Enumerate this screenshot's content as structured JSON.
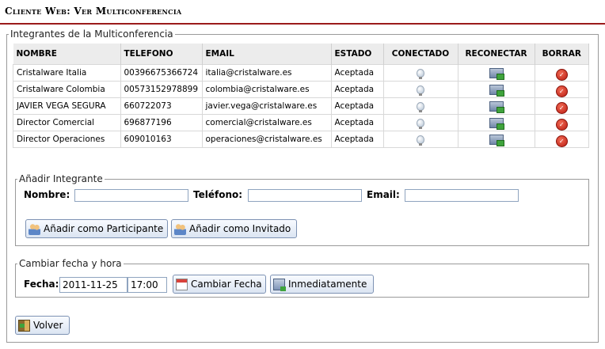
{
  "header": {
    "title": "Cliente Web: Ver Multiconferencia"
  },
  "members": {
    "legend": "Integrantes de la Multiconferencia",
    "columns": [
      "NOMBRE",
      "TELEFONO",
      "EMAIL",
      "ESTADO",
      "CONECTADO",
      "RECONECTAR",
      "BORRAR"
    ],
    "rows": [
      {
        "name": "Cristalware Italia",
        "phone": "00396675366724",
        "email": "italia@cristalware.es",
        "status": "Aceptada"
      },
      {
        "name": "Cristalware Colombia",
        "phone": "00573152978899",
        "email": "colombia@cristalware.es",
        "status": "Aceptada"
      },
      {
        "name": "JAVIER VEGA SEGURA",
        "phone": "660722073",
        "email": "javier.vega@cristalware.es",
        "status": "Aceptada"
      },
      {
        "name": "Director Comercial",
        "phone": "696877196",
        "email": "comercial@cristalware.es",
        "status": "Aceptada"
      },
      {
        "name": "Director Operaciones",
        "phone": "609010163",
        "email": "operaciones@cristalware.es",
        "status": "Aceptada"
      }
    ],
    "icons": {
      "connected": "lightbulb-icon",
      "reconnect": "reconnect-icon",
      "delete": "trash-icon"
    }
  },
  "add": {
    "legend": "Añadir Integrante",
    "name_label": "Nombre:",
    "name_value": "",
    "phone_label": "Teléfono:",
    "phone_value": "",
    "email_label": "Email:",
    "email_value": "",
    "add_participant": "Añadir como Participante",
    "add_guest": "Añadir como Invitado"
  },
  "schedule": {
    "legend": "Cambiar fecha y hora",
    "date_label": "Fecha:",
    "date_value": "2011-11-25",
    "time_value": "17:00",
    "change_button": "Cambiar Fecha",
    "now_button": "Inmediatamente"
  },
  "back_button": "Volver",
  "colors": {
    "header_rule": "#9b1b1b",
    "table_header_bg": "#ececec",
    "button_border": "#7d92b3",
    "input_border": "#8fa4bf"
  }
}
